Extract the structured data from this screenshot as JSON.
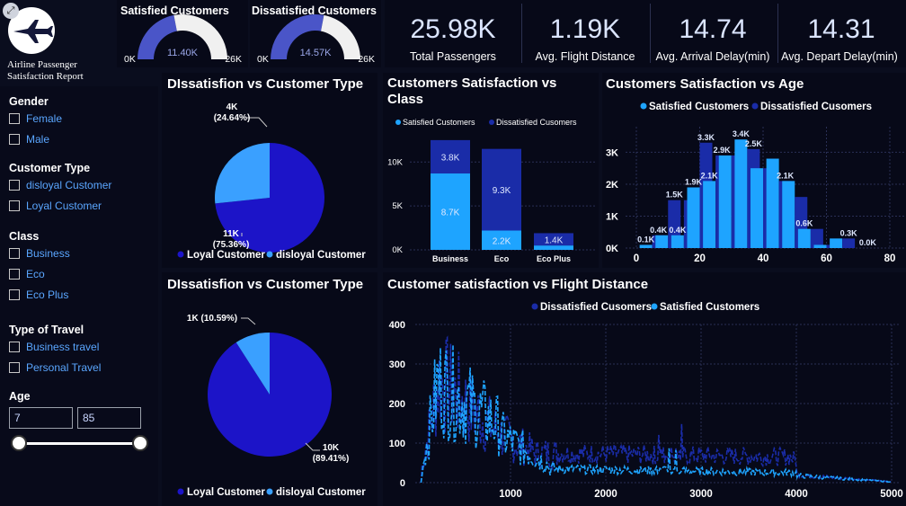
{
  "report": {
    "title_line1": "Airline Passenger",
    "title_line2": "Satisfaction Report"
  },
  "gauges": [
    {
      "title": "Satisfied Customers",
      "value_label": "11.40K",
      "value": 11400,
      "min_label": "0K",
      "max_label": "26K",
      "max": 26000
    },
    {
      "title": "Dissatisfied Customers",
      "value_label": "14.57K",
      "value": 14570,
      "min_label": "0K",
      "max_label": "26K",
      "max": 26000
    }
  ],
  "kpis": [
    {
      "value": "25.98K",
      "label": "Total Passengers"
    },
    {
      "value": "1.19K",
      "label": "Avg. Flight Distance"
    },
    {
      "value": "14.74",
      "label": "Avg. Arrival Delay(min)"
    },
    {
      "value": "14.31",
      "label": "Avg. Depart Delay(min)"
    }
  ],
  "filters": {
    "gender": {
      "title": "Gender",
      "items": [
        "Female",
        "Male"
      ]
    },
    "customer_type": {
      "title": "Customer Type",
      "items": [
        "disloyal Customer",
        "Loyal Customer"
      ]
    },
    "class": {
      "title": "Class",
      "items": [
        "Business",
        "Eco",
        "Eco Plus"
      ]
    },
    "travel": {
      "title": "Type of Travel",
      "items": [
        "Business travel",
        "Personal Travel"
      ]
    },
    "age": {
      "title": "Age",
      "min": "7",
      "max": "85"
    }
  },
  "colors": {
    "dark_blue": "#1c14c8",
    "light_blue": "#3aa0ff",
    "navy_bar": "#1a2ca8",
    "cyan_bar": "#1ea4ff",
    "accent": "#4a55ee"
  },
  "chart_data": [
    {
      "type": "pie",
      "title": "DIssatisfion vs Customer Type",
      "slices": [
        {
          "name": "Loyal Customer",
          "value": 11000,
          "label": "11K\n(75.36%)",
          "label_lines": [
            "11K",
            "(75.36%)"
          ],
          "percent": 75.36
        },
        {
          "name": "disloyal Customer",
          "value": 4000,
          "label": "4K\n(24.64%)",
          "label_lines": [
            "4K",
            "(24.64%)"
          ],
          "percent": 24.64
        }
      ],
      "legend": [
        "Loyal Customer",
        "disloyal Customer"
      ]
    },
    {
      "type": "pie",
      "title": "DIssatisfion vs Customer Type",
      "slices": [
        {
          "name": "Loyal Customer",
          "value": 10000,
          "label": "10K\n(89.41%)",
          "label_lines": [
            "10K",
            "(89.41%)"
          ],
          "percent": 89.41
        },
        {
          "name": "disloyal Customer",
          "value": 1000,
          "label": "1K (10.59%)",
          "label_lines": [
            "1K (10.59%)"
          ],
          "percent": 10.59
        }
      ],
      "legend": [
        "Loyal Customer",
        "disloyal Customer"
      ]
    },
    {
      "type": "bar",
      "stacked": true,
      "title": "Customers Satisfaction vs Class",
      "categories": [
        "Business",
        "Eco",
        "Eco Plus"
      ],
      "series": [
        {
          "name": "Satisfied Customers",
          "values": [
            8700,
            2200,
            500
          ],
          "labels": [
            "8.7K",
            "2.2K",
            ""
          ]
        },
        {
          "name": "Dissatisfied Cusomers",
          "values": [
            3800,
            9300,
            1400
          ],
          "labels": [
            "3.8K",
            "9.3K",
            "1.4K"
          ]
        }
      ],
      "yticks": [
        "0K",
        "5K",
        "10K"
      ],
      "ylim": [
        0,
        13000
      ]
    },
    {
      "type": "bar",
      "title": "Customers Satisfaction vs Age",
      "x": [
        5,
        10,
        15,
        20,
        25,
        30,
        35,
        40,
        45,
        50,
        55,
        60,
        65,
        70,
        75,
        80
      ],
      "series": [
        {
          "name": "Satisfied Customers",
          "values": [
            100,
            400,
            400,
            1900,
            2100,
            2900,
            3400,
            2500,
            2800,
            2100,
            600,
            100,
            300,
            0,
            0,
            0
          ],
          "labels": [
            "0.1K",
            "",
            "0.4K",
            "1.9K",
            "2.1K",
            "",
            "3.4K",
            "",
            "",
            "",
            "0.6K",
            "",
            "",
            "",
            "0.0K",
            ""
          ]
        },
        {
          "name": "Dissatisfied Cusomers",
          "values": [
            400,
            1500,
            1500,
            3300,
            2900,
            2900,
            3100,
            2500,
            2100,
            1600,
            600,
            100,
            300,
            0,
            0,
            0
          ],
          "labels": [
            "0.4K",
            "1.5K",
            "",
            "3.3K",
            "2.9K",
            "",
            "2.5K",
            "",
            "2.1K",
            "",
            "",
            "",
            "0.3K",
            "",
            "",
            ""
          ]
        }
      ],
      "xticks": [
        "0",
        "20",
        "40",
        "60",
        "80"
      ],
      "yticks": [
        "0K",
        "1K",
        "2K",
        "3K"
      ],
      "xlim": [
        0,
        82
      ],
      "ylim": [
        0,
        3800
      ]
    },
    {
      "type": "line",
      "title": "Customer satisfaction vs Flight Distance",
      "series": [
        {
          "name": "Dissatisfied Cusomers"
        },
        {
          "name": "Satisfied Customers"
        }
      ],
      "xticks": [
        "1000",
        "2000",
        "3000",
        "4000",
        "5000"
      ],
      "yticks": [
        "0",
        "100",
        "200",
        "300",
        "400"
      ],
      "xlim": [
        0,
        5000
      ],
      "ylim": [
        0,
        400
      ]
    }
  ]
}
